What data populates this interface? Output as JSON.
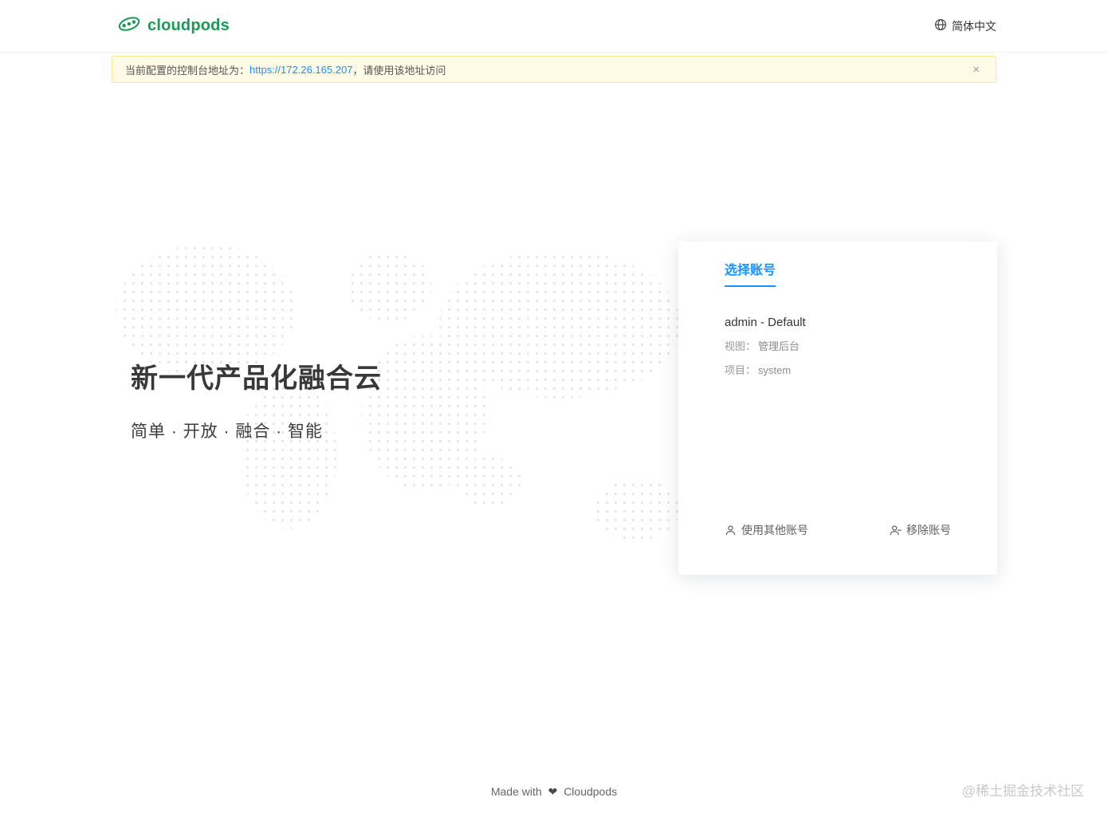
{
  "header": {
    "brand": "cloudpods",
    "language": "简体中文"
  },
  "alert": {
    "text_before": "当前配置的控制台地址为：",
    "link": "https://172.26.165.207",
    "text_after": "，请使用该地址访问",
    "close": "×"
  },
  "hero": {
    "title": "新一代产品化融合云",
    "subtitle": "简单 · 开放 · 融合 · 智能"
  },
  "account_card": {
    "tab": "选择账号",
    "account": {
      "name": "admin - Default",
      "view_label": "视图：",
      "view_value": "管理后台",
      "project_label": "项目：",
      "project_value": "system"
    },
    "actions": {
      "use_other": "使用其他账号",
      "remove": "移除账号"
    }
  },
  "footer": {
    "made_with": "Made with",
    "heart": "❤",
    "brand": "Cloudpods",
    "watermark": "@稀土掘金技术社区"
  },
  "colors": {
    "brand_green": "#1a9a55",
    "accent_blue": "#1890ff",
    "warning_bg": "#fffbe6",
    "warning_border": "#ffe58f"
  }
}
